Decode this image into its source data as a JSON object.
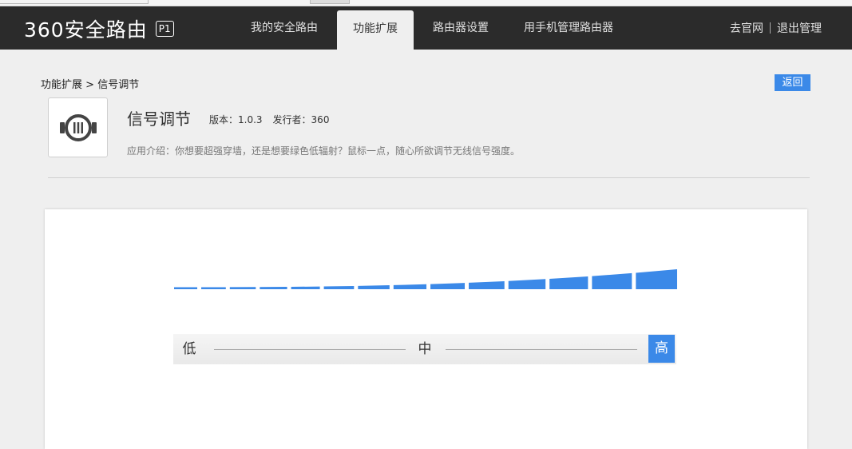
{
  "header": {
    "logo_text": "360安全路由",
    "model_badge": "P1",
    "tabs": [
      {
        "label": "我的安全路由"
      },
      {
        "label": "功能扩展"
      },
      {
        "label": "路由器设置"
      },
      {
        "label": "用手机管理路由器"
      }
    ],
    "active_tab": 1,
    "right_links": {
      "official_site": "去官网",
      "logout": "退出管理"
    }
  },
  "breadcrumb": {
    "parent": "功能扩展",
    "separator": ">",
    "current": "信号调节"
  },
  "back_button": "返回",
  "app": {
    "icon": "signal-adjust-icon",
    "title": "信号调节",
    "version": "版本：1.0.3",
    "publisher": "发行者：360",
    "description": "应用介绍：你想要超强穿墙，还是想要绿色低辐射？鼠标一点，随心所欲调节无线信号强度。"
  },
  "signal": {
    "bar_count": 14,
    "level": 1.0,
    "accent_color": "#3b89e8",
    "labels": {
      "low": "低",
      "mid": "中",
      "high": "高"
    },
    "selected": "high"
  }
}
